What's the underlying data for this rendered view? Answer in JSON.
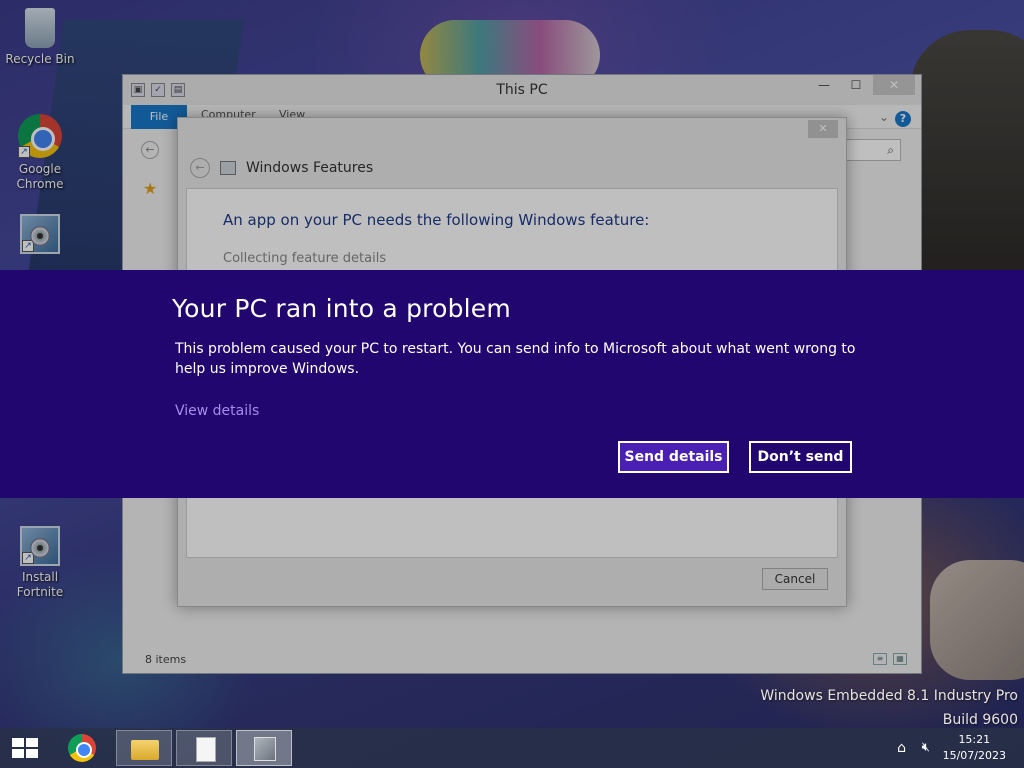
{
  "desktop": {
    "icons": [
      {
        "label": "Recycle Bin"
      },
      {
        "label": "Google Chrome"
      },
      {
        "label": "Install Fortnite"
      }
    ]
  },
  "explorer": {
    "title": "This PC",
    "tabs": [
      "File",
      "Computer",
      "View"
    ],
    "status": "8 items",
    "close_label": "✕",
    "minimize_label": "—",
    "maximize_label": "☐"
  },
  "features": {
    "title": "Windows Features",
    "message": "An app on your PC needs the following Windows feature:",
    "status": "Collecting feature details",
    "cancel_label": "Cancel"
  },
  "error": {
    "headline": "Your PC ran into a problem",
    "message": "This problem caused your PC to restart. You can send info to Microsoft about what went wrong to help us improve Windows.",
    "details_link": "View details",
    "send_button": "Send details",
    "dont_send_button": "Don’t send",
    "background_color": "#22066f",
    "send_button_color": "#4a1fb3"
  },
  "watermark": {
    "line1": "Windows Embedded 8.1 Industry Pro",
    "line2": "Build 9600"
  },
  "taskbar": {
    "time": "15:21",
    "date": "15/07/2023"
  }
}
